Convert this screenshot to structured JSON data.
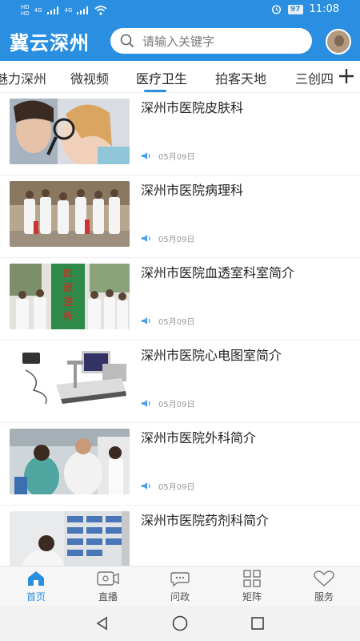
{
  "status_bar": {
    "signal1": "HD",
    "signal2": "HD",
    "network1": "4G",
    "network2": "4G",
    "battery": "97",
    "time": "11:08"
  },
  "header": {
    "brand": "冀云深州",
    "search_placeholder": "请输入关键字"
  },
  "tabs": [
    {
      "label": "魅力深州"
    },
    {
      "label": "微视频"
    },
    {
      "label": "医疗卫生"
    },
    {
      "label": "拍客天地"
    },
    {
      "label": "三创四"
    }
  ],
  "active_tab": "医疗卫生",
  "articles": [
    {
      "title": "深州市医院皮肤科",
      "date": "05月09日",
      "thumb": "dermatology"
    },
    {
      "title": "深州市医院病理科",
      "date": "05月09日",
      "thumb": "pathology"
    },
    {
      "title": "深州市医院血透室科室简介",
      "date": "05月09日",
      "thumb": "dialysis",
      "sign_text": "血液透析室"
    },
    {
      "title": "深州市医院心电图室简介",
      "date": "05月09日",
      "thumb": "ecg"
    },
    {
      "title": "深州市医院外科简介",
      "date": "05月09日",
      "thumb": "surgery"
    },
    {
      "title": "深州市医院药剂科简介",
      "date": "",
      "thumb": "pharmacy"
    }
  ],
  "bottom_nav": [
    {
      "label": "首页",
      "icon": "home-icon",
      "active": true
    },
    {
      "label": "直播",
      "icon": "camera-icon",
      "active": false
    },
    {
      "label": "问政",
      "icon": "chat-icon",
      "active": false
    },
    {
      "label": "矩阵",
      "icon": "grid-icon",
      "active": false
    },
    {
      "label": "服务",
      "icon": "heart-icon",
      "active": false
    }
  ],
  "colors": {
    "brand_blue": "#2a8fe0",
    "audio_icon": "#4a9ee8"
  }
}
